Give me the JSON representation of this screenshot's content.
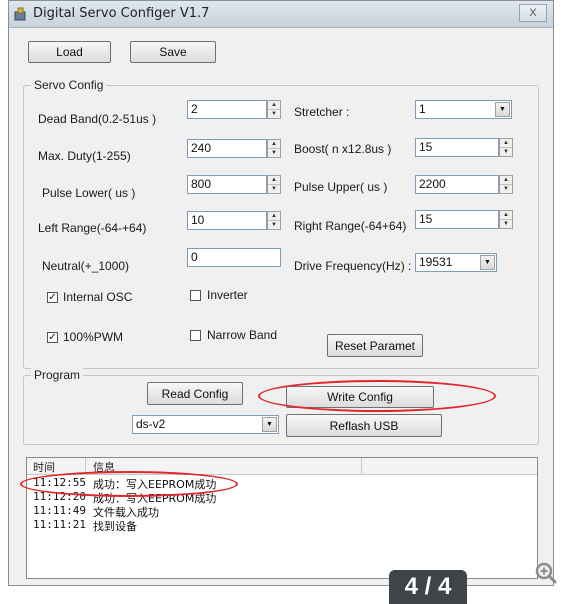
{
  "window": {
    "title": "Digital Servo Configer V1.7",
    "close_label": "X"
  },
  "toolbar": {
    "load_label": "Load",
    "save_label": "Save"
  },
  "servo_config": {
    "group_label": "Servo Config",
    "dead_band": {
      "label": "Dead Band(0.2-51us )",
      "value": "2"
    },
    "stretcher": {
      "label": "Stretcher :",
      "value": "1"
    },
    "max_duty": {
      "label": "Max. Duty(1-255)",
      "value": "240"
    },
    "boost": {
      "label": "Boost( n x12.8us )",
      "value": "15"
    },
    "pulse_lower": {
      "label": "Pulse Lower( us )",
      "value": "800"
    },
    "pulse_upper": {
      "label": "Pulse Upper( us )",
      "value": "2200"
    },
    "left_range": {
      "label": "Left Range(-64-+64)",
      "value": "10"
    },
    "right_range": {
      "label": "Right Range(-64+64)",
      "value": "15"
    },
    "neutral": {
      "label": "Neutral(+_1000)",
      "value": "0"
    },
    "drive_frequency": {
      "label": "Drive Frequency(Hz) :",
      "value": "19531"
    },
    "internal_osc": {
      "label": "Internal OSC",
      "checked": true
    },
    "inverter": {
      "label": "Inverter",
      "checked": false
    },
    "pwm100": {
      "label": "100%PWM",
      "checked": true
    },
    "narrow_band": {
      "label": "Narrow Band",
      "checked": false
    },
    "reset_label": "Reset Paramet"
  },
  "program": {
    "group_label": "Program",
    "read_config_label": "Read Config",
    "write_config_label": "Write Config",
    "model_value": "ds-v2",
    "reflash_label": "Reflash USB"
  },
  "log": {
    "columns": [
      "时间",
      "信息"
    ],
    "rows": [
      {
        "time": "11:12:55",
        "message": "成功：写入EEPROM成功"
      },
      {
        "time": "11:12:20",
        "message": "成功：写入EEPROM成功"
      },
      {
        "time": "11:11:49",
        "message": "文件载入成功"
      },
      {
        "time": "11:11:21",
        "message": "找到设备"
      }
    ]
  },
  "overlay": {
    "page_indicator": "4 / 4",
    "zoom_icon": "zoom-in-icon"
  },
  "colors": {
    "annotation": "#e0252b",
    "badge": "#3f4448"
  }
}
